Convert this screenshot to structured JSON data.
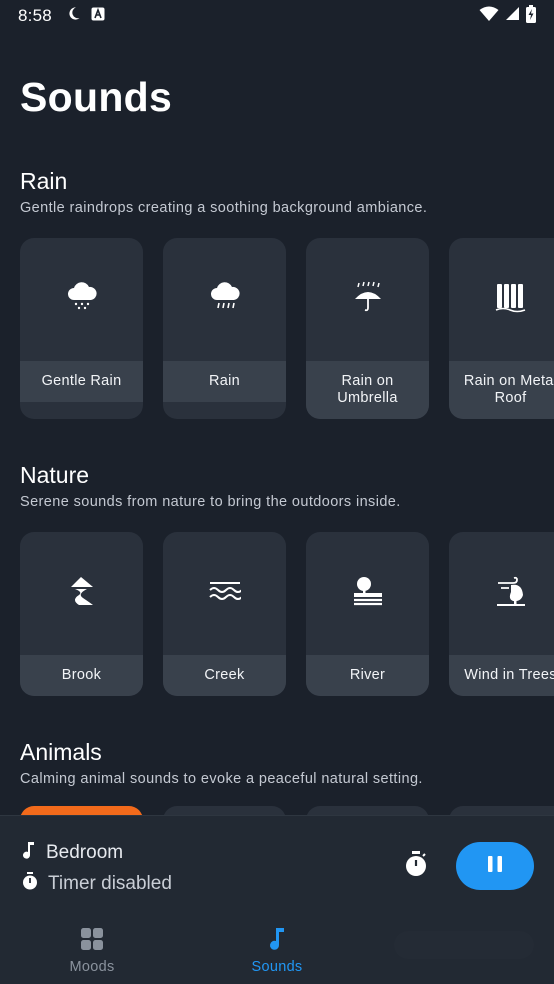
{
  "status_bar": {
    "time": "8:58",
    "left_icons": [
      "moon-icon",
      "a-badge-icon"
    ],
    "right_icons": [
      "wifi-icon",
      "signal-icon",
      "battery-charging-icon"
    ]
  },
  "page": {
    "title": "Sounds"
  },
  "sections": [
    {
      "title": "Rain",
      "description": "Gentle raindrops creating a soothing background ambiance.",
      "cards": [
        {
          "label": "Gentle Rain",
          "icon": "cloud-drizzle-icon"
        },
        {
          "label": "Rain",
          "icon": "cloud-rain-icon"
        },
        {
          "label": "Rain on\nUmbrella",
          "icon": "umbrella-rain-icon"
        },
        {
          "label": "Rain on Metal\nRoof",
          "icon": "metal-roof-icon"
        }
      ]
    },
    {
      "title": "Nature",
      "description": "Serene sounds from nature to bring the outdoors inside.",
      "cards": [
        {
          "label": "Brook",
          "icon": "brook-icon"
        },
        {
          "label": "Creek",
          "icon": "waves-icon"
        },
        {
          "label": "River",
          "icon": "river-landscape-icon"
        },
        {
          "label": "Wind in Trees",
          "icon": "wind-tree-icon"
        }
      ]
    },
    {
      "title": "Animals",
      "description": "Calming animal sounds to evoke a peaceful natural setting."
    }
  ],
  "player": {
    "mix_name": "Bedroom",
    "timer_status": "Timer disabled",
    "state": "playing"
  },
  "bottom_nav": {
    "items": [
      {
        "label": "Moods",
        "icon": "grid-icon",
        "active": false
      },
      {
        "label": "Sounds",
        "icon": "music-note-icon",
        "active": true
      }
    ]
  },
  "colors": {
    "background": "#1b212b",
    "card": "#2a313c",
    "card_label": "#39414c",
    "accent": "#2196f3",
    "active_card": "#f26a1b"
  }
}
